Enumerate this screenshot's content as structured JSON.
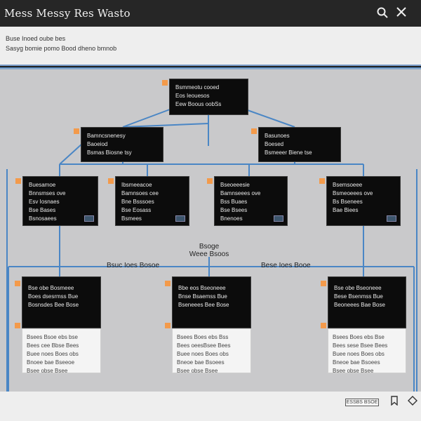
{
  "window": {
    "title": "Mess Messy Res Wasto"
  },
  "description": {
    "line1": "Buse Inoed oube bes",
    "line2": "Sasyg bomie pomo Bood dheno bmnob"
  },
  "diagram": {
    "root": {
      "lines": [
        "Bsmmeotu cooed",
        "Eos Ieouesos",
        "Eew Boous oobSs"
      ]
    },
    "level2": [
      {
        "lines": [
          "Bamncsnenesy",
          "Baoeiod",
          "Bsmas Biosne tsy"
        ]
      },
      {
        "lines": [
          "Basunoes",
          "Boesed",
          "Bsmeeer Biene tse"
        ]
      }
    ],
    "level3": [
      {
        "lines": [
          "Buesamoe",
          "Bnnsmses ove",
          "Esv Iosnaes",
          "Bse Bases",
          "Bsnosaees"
        ]
      },
      {
        "lines": [
          "Ibsmeeacoe",
          "Bamnsoes cee",
          "Bne Bsssoes",
          "Bse Eosass",
          "Bsmees"
        ]
      },
      {
        "lines": [
          "Bseoeeesie",
          "Bamnseees ove",
          "Bss Buaes",
          "Bse Bsees",
          "Bnenoes"
        ]
      },
      {
        "lines": [
          "Bsemsoeee",
          "Bsmeoeees ove",
          "Bs Bsenees",
          "Bae Biees"
        ]
      }
    ],
    "center_label": [
      "Bsoge",
      "Weee Bsoos"
    ],
    "branch_labels": [
      "Bsuc Ioes Bosoe",
      "Bese Ioes Booe"
    ],
    "level4": [
      {
        "head": [
          "Bse obe Bosmeee",
          "Boes dsesrmss Bue",
          "Bosnsdes Bee Bose"
        ],
        "foot": [
          "Bsees Bsoe ebs bse",
          "Bees cee Bbse Bees",
          "Buee noes Boes obs",
          "Bnoee bae Bseeoe",
          "Bsee obse Bsee"
        ]
      },
      {
        "head": [
          "Bbe eos Bseoneee",
          "Bnse Bsaemss Bue",
          "Bseneees Bee Bose"
        ],
        "foot": [
          "Bsees Boes ebs Bss",
          "Bees oeesBsee Bees",
          "Buee noes Boes obs",
          "Bneoe bae Bsoees",
          "Bsee obse Bsee"
        ]
      },
      {
        "head": [
          "Bse obe Bseoneee",
          "Bese Bsenmss Bue",
          "Beoneees Bae Bose"
        ],
        "foot": [
          "Bsees Boes ebs Bse",
          "Bees sese Bsee Bees",
          "Buee noes Boes obs",
          "Bneoe bae Bsoees",
          "Bsee obse Bsee"
        ]
      }
    ]
  },
  "statusbar": {
    "field": "ESSBS BSOE"
  },
  "colors": {
    "connector": "#4a86c5",
    "handle": "#f39a4b",
    "node": "#0c0c0c",
    "canvas": "#c9c9cb"
  },
  "icons": {
    "search": "search-icon",
    "close": "close-icon",
    "status1": "bookmark-icon",
    "status2": "diamond-icon"
  }
}
